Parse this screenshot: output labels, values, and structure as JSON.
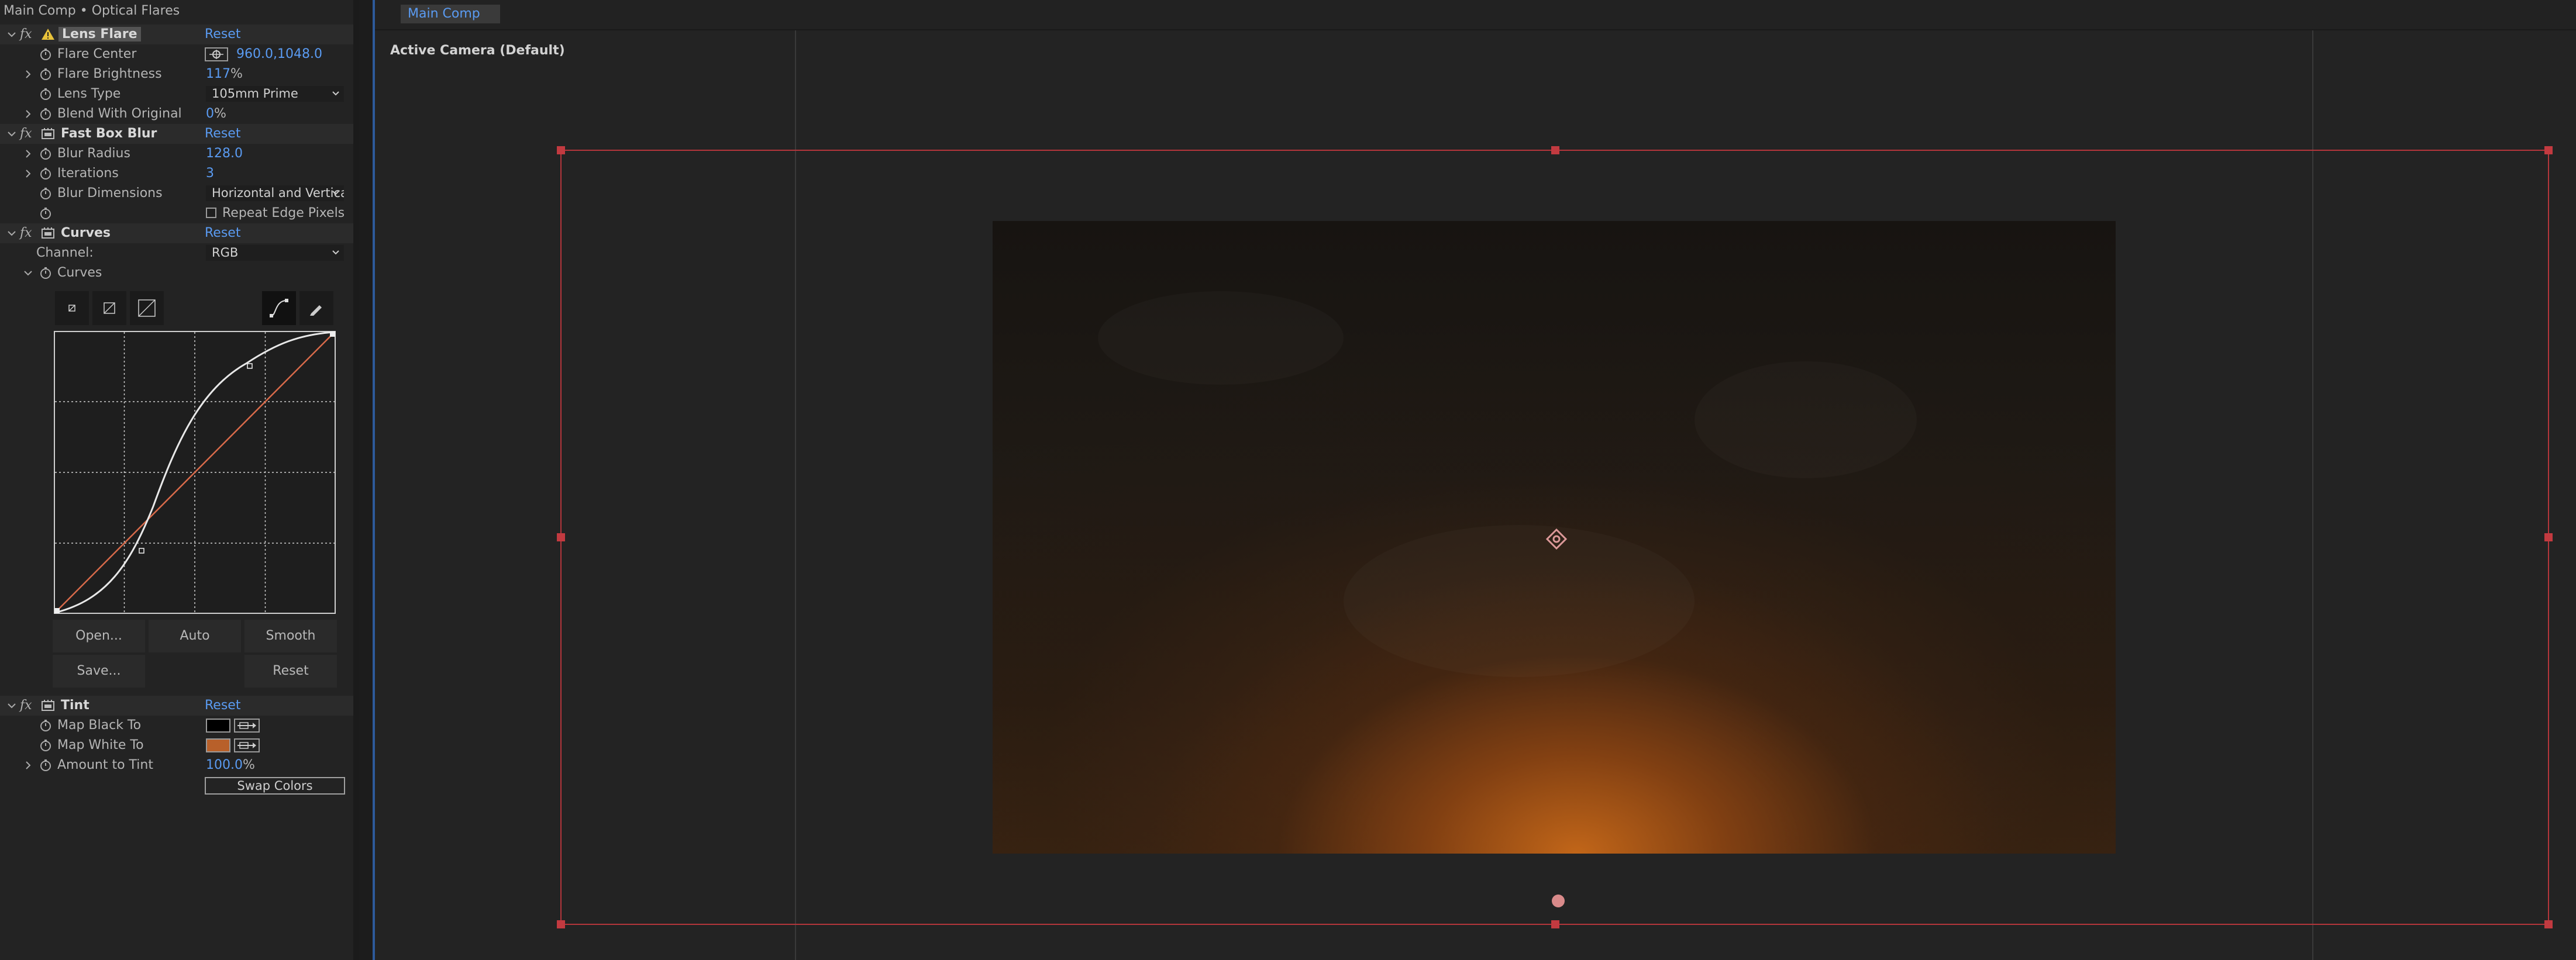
{
  "effect_controls": {
    "title": "Main Comp • Optical Flares",
    "effects": {
      "lens_flare": {
        "fx": "fx",
        "name": "Lens Flare",
        "reset": "Reset",
        "flare_center": {
          "label": "Flare Center",
          "value": "960.0,1048.0"
        },
        "flare_brightness": {
          "label": "Flare Brightness",
          "value": "117",
          "unit": "%"
        },
        "lens_type": {
          "label": "Lens Type",
          "value": "105mm Prime"
        },
        "blend_with_original": {
          "label": "Blend With Original",
          "value": "0",
          "unit": "%"
        }
      },
      "fast_box_blur": {
        "fx": "fx",
        "name": "Fast Box Blur",
        "reset": "Reset",
        "blur_radius": {
          "label": "Blur Radius",
          "value": "128.0"
        },
        "iterations": {
          "label": "Iterations",
          "value": "3"
        },
        "blur_dimensions": {
          "label": "Blur Dimensions",
          "value": "Horizontal and Vertical"
        },
        "repeat_edge_pixels": {
          "label": "Repeat Edge Pixels",
          "checked": false
        }
      },
      "curves": {
        "fx": "fx",
        "name": "Curves",
        "reset": "Reset",
        "channel": {
          "label": "Channel:",
          "value": "RGB"
        },
        "curves_prop": {
          "label": "Curves"
        },
        "buttons": {
          "open": "Open...",
          "auto": "Auto",
          "smooth": "Smooth",
          "save": "Save...",
          "reset": "Reset"
        }
      },
      "tint": {
        "fx": "fx",
        "name": "Tint",
        "reset": "Reset",
        "map_black_to": {
          "label": "Map Black To",
          "color": "#000000"
        },
        "map_white_to": {
          "label": "Map White To",
          "color": "#b8602a"
        },
        "amount_to_tint": {
          "label": "Amount to Tint",
          "value": "100.0",
          "unit": "%"
        },
        "swap_colors": "Swap Colors"
      }
    }
  },
  "composition": {
    "tab": "Main Comp",
    "camera": "Active Camera (Default)"
  },
  "colors": {
    "accent_blue": "#5a9bf2",
    "layer_bounds_red": "#b3353b",
    "curve_diagonal": "#d86a4a",
    "curve_line": "#e8e8e8"
  }
}
